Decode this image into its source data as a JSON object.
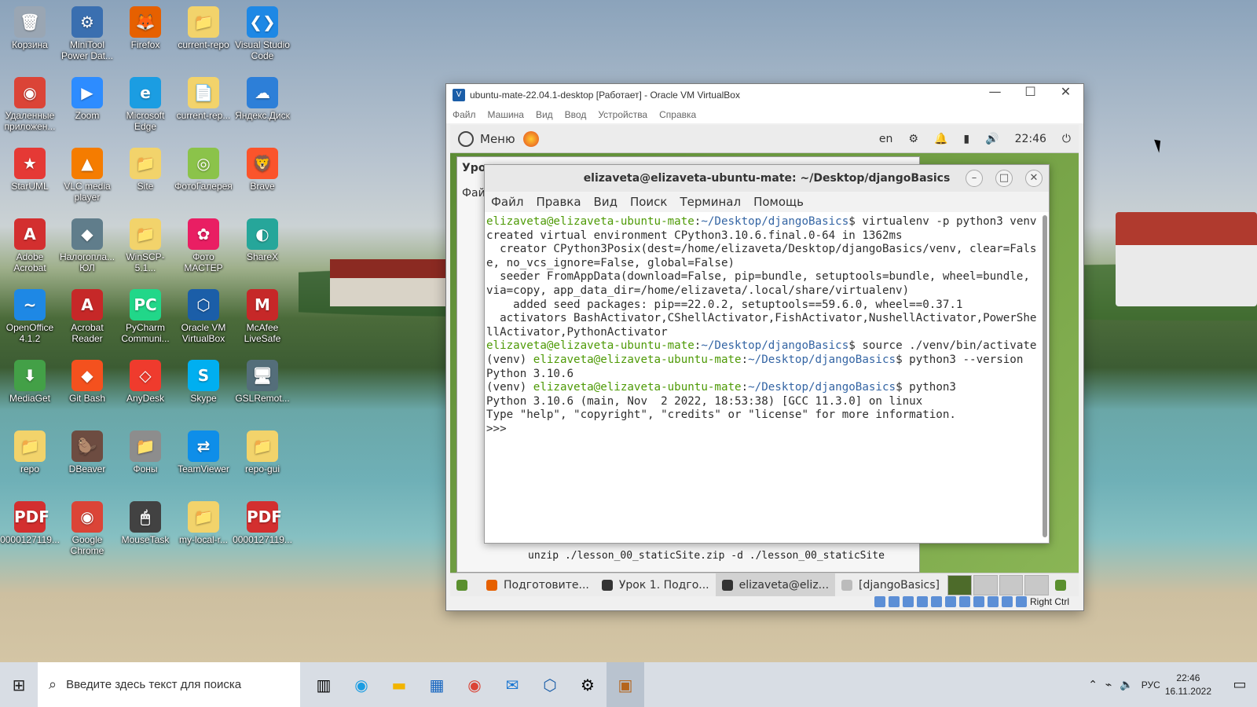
{
  "desktop": {
    "icons": [
      {
        "label": "Корзина",
        "glyph": "🗑",
        "color": "#9aa6b3"
      },
      {
        "label": "MiniTool Power Dat...",
        "glyph": "⚙",
        "color": "#3a6fb0"
      },
      {
        "label": "Firefox",
        "glyph": "🦊",
        "color": "#e66000"
      },
      {
        "label": "current-repo",
        "glyph": "📁",
        "color": "#f2d36b"
      },
      {
        "label": "Visual Studio Code",
        "glyph": "❮❯",
        "color": "#1e88e5"
      },
      {
        "label": "Удаленные приложен...",
        "glyph": "◉",
        "color": "#db4437"
      },
      {
        "label": "Zoom",
        "glyph": "▶",
        "color": "#2d8cff"
      },
      {
        "label": "Microsoft Edge",
        "glyph": "e",
        "color": "#1b9de2"
      },
      {
        "label": "current-rep...",
        "glyph": "📄",
        "color": "#f2d36b"
      },
      {
        "label": "Яндекс.Диск",
        "glyph": "☁",
        "color": "#2d7fd8"
      },
      {
        "label": "StarUML",
        "glyph": "★",
        "color": "#e53935"
      },
      {
        "label": "VLC media player",
        "glyph": "▲",
        "color": "#f57c00"
      },
      {
        "label": "Site",
        "glyph": "📁",
        "color": "#f2d36b"
      },
      {
        "label": "ФотоГалерея",
        "glyph": "◎",
        "color": "#8bc34a"
      },
      {
        "label": "Brave",
        "glyph": "🦁",
        "color": "#fb542b"
      },
      {
        "label": "Adobe Acrobat",
        "glyph": "A",
        "color": "#d32f2f"
      },
      {
        "label": "Налогопла... ЮЛ",
        "glyph": "◆",
        "color": "#607d8b"
      },
      {
        "label": "WinSCP-5.1...",
        "glyph": "📁",
        "color": "#f2d36b"
      },
      {
        "label": "Фото МАСТЕР",
        "glyph": "✿",
        "color": "#e91e63"
      },
      {
        "label": "ShareX",
        "glyph": "◐",
        "color": "#26a69a"
      },
      {
        "label": "OpenOffice 4.1.2",
        "glyph": "~",
        "color": "#1e88e5"
      },
      {
        "label": "Acrobat Reader",
        "glyph": "A",
        "color": "#c62828"
      },
      {
        "label": "PyCharm Communi...",
        "glyph": "PC",
        "color": "#21d789"
      },
      {
        "label": "Oracle VM VirtualBox",
        "glyph": "⬡",
        "color": "#1b5ea8"
      },
      {
        "label": "McAfee LiveSafe",
        "glyph": "M",
        "color": "#c62828"
      },
      {
        "label": "MediaGet",
        "glyph": "⬇",
        "color": "#43a047"
      },
      {
        "label": "Git Bash",
        "glyph": "◆",
        "color": "#f4511e"
      },
      {
        "label": "AnyDesk",
        "glyph": "◇",
        "color": "#ef3b2d"
      },
      {
        "label": "Skype",
        "glyph": "S",
        "color": "#00aff0"
      },
      {
        "label": "GSLRemot...",
        "glyph": "🖥",
        "color": "#546e7a"
      },
      {
        "label": "repo",
        "glyph": "📁",
        "color": "#f2d36b"
      },
      {
        "label": "DBeaver",
        "glyph": "🦫",
        "color": "#6d4c41"
      },
      {
        "label": "Фоны",
        "glyph": "📁",
        "color": "#8d8d8d"
      },
      {
        "label": "TeamViewer",
        "glyph": "⇄",
        "color": "#0e8ee9"
      },
      {
        "label": "repo-gui",
        "glyph": "📁",
        "color": "#f2d36b"
      },
      {
        "label": "0000127119...",
        "glyph": "PDF",
        "color": "#d32f2f"
      },
      {
        "label": "Google Chrome",
        "glyph": "◉",
        "color": "#db4437"
      },
      {
        "label": "MouseTask",
        "glyph": "🖱",
        "color": "#424242"
      },
      {
        "label": "my-local-r...",
        "glyph": "📁",
        "color": "#f2d36b"
      },
      {
        "label": "0000127119...",
        "glyph": "PDF",
        "color": "#d32f2f"
      }
    ]
  },
  "vbox": {
    "title": "ubuntu-mate-22.04.1-desktop [Работает] - Oracle VM VirtualBox",
    "menu": [
      "Файл",
      "Машина",
      "Вид",
      "Ввод",
      "Устройства",
      "Справка"
    ],
    "status_hostkey": "Right Ctrl"
  },
  "guest": {
    "panel": {
      "menu_label": "Меню",
      "keyboard": "en",
      "time": "22:46"
    },
    "bg_window": {
      "title_fragment": "Урок",
      "menu_fragment": "Фай",
      "command": "unzip ./lesson_00_staticSite.zip -d ./lesson_00_staticSite"
    },
    "terminal": {
      "title": "elizaveta@elizaveta-ubuntu-mate: ~/Desktop/djangoBasics",
      "menu": [
        "Файл",
        "Правка",
        "Вид",
        "Поиск",
        "Терминал",
        "Помощь"
      ],
      "user": "elizaveta@elizaveta-ubuntu-mate",
      "path": "~/Desktop/djangoBasics",
      "venv": "(venv) ",
      "cmd1": "virtualenv -p python3 venv",
      "out1": "created virtual environment CPython3.10.6.final.0-64 in 1362ms\n  creator CPython3Posix(dest=/home/elizaveta/Desktop/djangoBasics/venv, clear=False, no_vcs_ignore=False, global=False)\n  seeder FromAppData(download=False, pip=bundle, setuptools=bundle, wheel=bundle, via=copy, app_data_dir=/home/elizaveta/.local/share/virtualenv)\n    added seed packages: pip==22.0.2, setuptools==59.6.0, wheel==0.37.1\n  activators BashActivator,CShellActivator,FishActivator,NushellActivator,PowerShellActivator,PythonActivator",
      "cmd2": "source ./venv/bin/activate",
      "cmd3": "python3 --version",
      "out3": "Python 3.10.6",
      "cmd4": "python3",
      "out4": "Python 3.10.6 (main, Nov  2 2022, 18:53:38) [GCC 11.3.0] on linux\nType \"help\", \"copyright\", \"credits\" or \"license\" for more information.\n>>>"
    },
    "taskbar": [
      {
        "label": "Подготовите...",
        "color": "#e66000"
      },
      {
        "label": "Урок 1. Подго...",
        "color": "#333"
      },
      {
        "label": "elizaveta@eliz...",
        "color": "#333"
      },
      {
        "label": "[djangoBasics]",
        "color": "#bbb"
      }
    ]
  },
  "win_taskbar": {
    "search_placeholder": "Введите здесь текст для поиска",
    "lang": "РУС",
    "time": "22:46",
    "date": "16.11.2022"
  }
}
